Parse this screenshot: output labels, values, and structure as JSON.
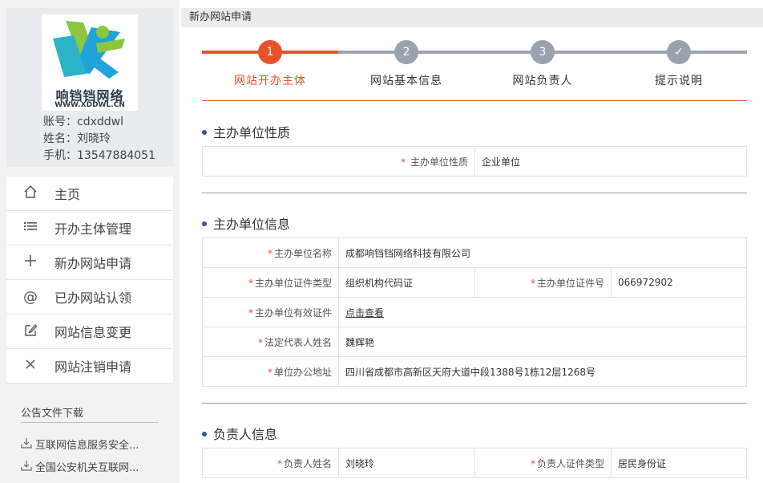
{
  "profile": {
    "logo_text": "响铛铛网络",
    "logo_sub": "WWW.XDDWL.CN",
    "account": "账号：cdxddwl",
    "name": "姓名：刘晓玲",
    "phone": "手机：13547884051"
  },
  "menu": [
    {
      "label": "主页",
      "icon": "home-icon"
    },
    {
      "label": "开办主体管理",
      "icon": "list-icon"
    },
    {
      "label": "新办网站申请",
      "icon": "plus-icon"
    },
    {
      "label": "已办网站认领",
      "icon": "at-icon"
    },
    {
      "label": "网站信息变更",
      "icon": "edit-icon"
    },
    {
      "label": "网站注销申请",
      "icon": "close-icon"
    }
  ],
  "downloads": {
    "title": "公告文件下载",
    "items": [
      "互联网信息服务安全...",
      "全国公安机关互联网..."
    ]
  },
  "breadcrumb": "新办网站申请",
  "steps": [
    {
      "num": "1",
      "label": "网站开办主体"
    },
    {
      "num": "2",
      "label": "网站基本信息"
    },
    {
      "num": "3",
      "label": "网站负责人"
    },
    {
      "num": "✓",
      "label": "提示说明"
    }
  ],
  "colors": {
    "accent": "#e8522b",
    "inactive": "#9aa3ad",
    "dot": "#3a53a4"
  },
  "section1": {
    "title": "主办单位性质",
    "label": "主办单位性质",
    "value": "企业单位"
  },
  "section2": {
    "title": "主办单位信息",
    "name_label": "主办单位名称",
    "name_value": "成都响铛铛网络科技有限公司",
    "cert_type_label": "主办单位证件类型",
    "cert_type_value": "组织机构代码证",
    "cert_no_label": "主办单位证件号",
    "cert_no_value": "066972902",
    "valid_cert_label": "主办单位有效证件",
    "valid_cert_value": "点击查看",
    "legal_label": "法定代表人姓名",
    "legal_value": "魏辉艳",
    "addr_label": "单位办公地址",
    "addr_value": "四川省成都市高新区天府大道中段1388号1栋12层1268号"
  },
  "section3": {
    "title": "负责人信息",
    "name_label": "负责人姓名",
    "name_value": "刘晓玲",
    "cert_label": "负责人证件类型",
    "cert_value": "居民身份证"
  }
}
